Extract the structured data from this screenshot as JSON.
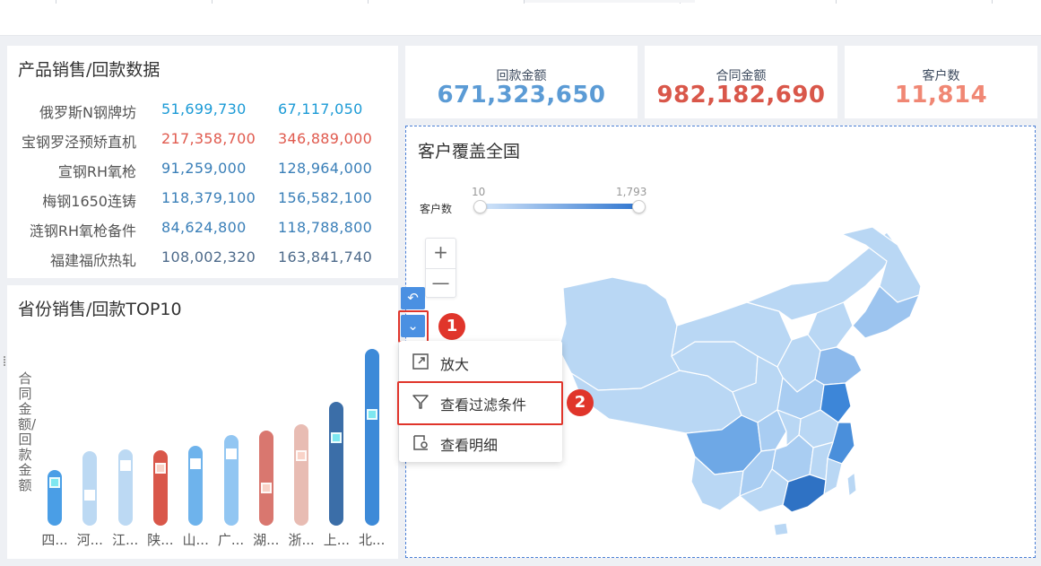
{
  "product_panel": {
    "title": "产品销售/回款数据",
    "rows": [
      {
        "name": "俄罗斯N钢牌坊",
        "v1": "51,699,730",
        "v2": "67,117,050",
        "color": "#1a9ad6"
      },
      {
        "name": "宝钢罗泾预矫直机",
        "v1": "217,358,700",
        "v2": "346,889,000",
        "color": "#e05a4e"
      },
      {
        "name": "宣钢RH氧枪",
        "v1": "91,259,000",
        "v2": "128,964,000",
        "color": "#3a7fb8"
      },
      {
        "name": "梅钢1650连铸",
        "v1": "118,379,100",
        "v2": "156,582,100",
        "color": "#3a7fb8"
      },
      {
        "name": "涟钢RH氧枪备件",
        "v1": "84,624,800",
        "v2": "118,788,800",
        "color": "#3a7fb8"
      },
      {
        "name": "福建福欣热轧",
        "v1": "108,002,320",
        "v2": "163,841,740",
        "color": "#4d6a8a"
      }
    ]
  },
  "kpis": [
    {
      "label": "回款金额",
      "value": "671,323,650",
      "color": "#5b9bd5"
    },
    {
      "label": "合同金额",
      "value": "982,182,690",
      "color": "#d9574a"
    },
    {
      "label": "客户数",
      "value": "11,814",
      "color": "#f08774"
    }
  ],
  "bar_panel": {
    "title": "省份销售/回款TOP10",
    "ylabel": "合同金额/回款金额"
  },
  "chart_data": {
    "type": "bar",
    "title": "省份销售/回款TOP10",
    "ylabel": "合同金额/回款金额",
    "categories": [
      "四...",
      "河...",
      "江...",
      "陕...",
      "山...",
      "广...",
      "湖...",
      "浙...",
      "上...",
      "北..."
    ],
    "bar_colors": [
      "#4a9ee6",
      "#bcd9f3",
      "#bcd9f3",
      "#d9574a",
      "#6eb3ec",
      "#92c6f2",
      "#d9776f",
      "#e8bcb3",
      "#3b6ea8",
      "#3d8ad8"
    ],
    "series": [
      {
        "values": [
          62,
          83,
          85,
          84,
          89,
          101,
          106,
          113,
          138,
          197
        ]
      },
      {
        "values": [
          48,
          34,
          67,
          64,
          69,
          80,
          42,
          78,
          98,
          124
        ]
      }
    ],
    "ylim": [
      0,
      200
    ]
  },
  "map_panel": {
    "title": "客户覆盖全国",
    "legend_label": "客户数",
    "legend_min": "10",
    "legend_max": "1,793",
    "zoom_in": "+",
    "zoom_out": "—"
  },
  "toolbar": {
    "back_icon": "↶",
    "dropdown_icon": "⌄"
  },
  "badges": [
    "1",
    "2"
  ],
  "menu": {
    "items": [
      {
        "label": "放大",
        "icon": "expand-icon"
      },
      {
        "label": "查看过滤条件",
        "icon": "filter-icon"
      },
      {
        "label": "查看明细",
        "icon": "detail-icon"
      }
    ]
  }
}
